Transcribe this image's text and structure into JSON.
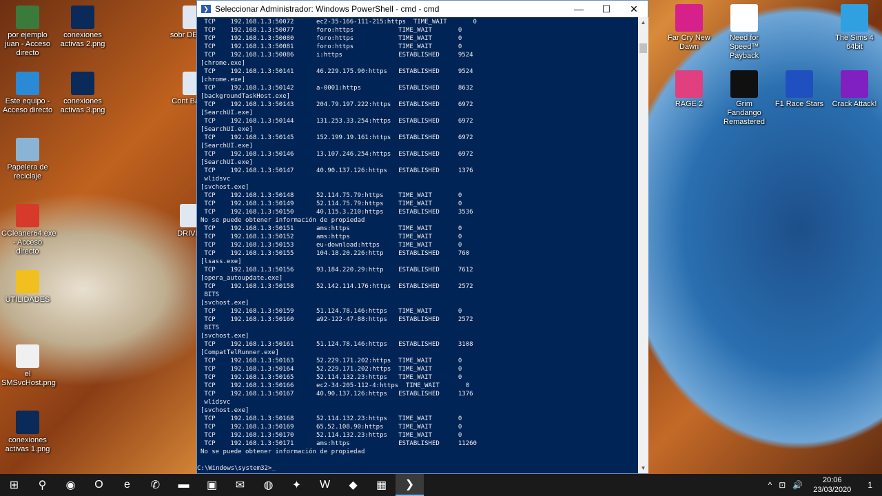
{
  "desktop": {
    "left_icons": [
      {
        "label": "por ejemplo juan - Acceso directo",
        "color": "#3a7a3a"
      },
      {
        "label": "conexiones activas 2.png",
        "color": "#0a2a5a"
      },
      {
        "label": "Este equipo - Acceso directo",
        "color": "#2a8ad6"
      },
      {
        "label": "conexiones activas 3.png",
        "color": "#0a2a5a"
      },
      {
        "label": "Papelera de reciclaje",
        "color": "#8ab4d6"
      },
      {
        "label": "CCleaner64.exe - Acceso directo",
        "color": "#d63a2a"
      },
      {
        "label": "UTILIDADES",
        "color": "#f0c020"
      },
      {
        "label": "el SMSvcHost.png",
        "color": "#f0f0f0"
      },
      {
        "label": "conexiones activas 1.png",
        "color": "#0a2a5a"
      }
    ],
    "partial_icons": [
      {
        "label": "sobr DESCAR"
      },
      {
        "label": "Cont Bascule"
      },
      {
        "label": "DRIVER"
      }
    ],
    "right_icons": [
      {
        "label": "Far Cry New Dawn",
        "color": "#d6208a"
      },
      {
        "label": "Need for Speed™ Payback",
        "color": "#ffffff"
      },
      {
        "label": "The Sims 4 64bit",
        "color": "#30a0e0"
      },
      {
        "label": "RAGE 2",
        "color": "#e04080"
      },
      {
        "label": "Grim Fandango Remastered",
        "color": "#101010"
      },
      {
        "label": "F1 Race Stars",
        "color": "#2050c0"
      },
      {
        "label": "Crack Attack!",
        "color": "#8020c0"
      }
    ]
  },
  "window": {
    "title": "Seleccionar Administrador: Windows PowerShell - cmd - cmd",
    "minimize": "—",
    "maximize": "☐",
    "close": "✕"
  },
  "console": {
    "rows": [
      {
        "proto": "TCP",
        "local": "192.168.1.3:50072",
        "foreign": "ec2-35-166-111-215:https",
        "state": "TIME_WAIT",
        "pid": "0"
      },
      {
        "proto": "TCP",
        "local": "192.168.1.3:50077",
        "foreign": "foro:https",
        "state": "TIME_WAIT",
        "pid": "0"
      },
      {
        "proto": "TCP",
        "local": "192.168.1.3:50080",
        "foreign": "foro:https",
        "state": "TIME_WAIT",
        "pid": "0"
      },
      {
        "proto": "TCP",
        "local": "192.168.1.3:50081",
        "foreign": "foro:https",
        "state": "TIME_WAIT",
        "pid": "0"
      },
      {
        "proto": "TCP",
        "local": "192.168.1.3:50086",
        "foreign": "i:https",
        "state": "ESTABLISHED",
        "pid": "9524"
      },
      {
        "text": "[chrome.exe]"
      },
      {
        "proto": "TCP",
        "local": "192.168.1.3:50141",
        "foreign": "46.229.175.90:https",
        "state": "ESTABLISHED",
        "pid": "9524"
      },
      {
        "text": "[chrome.exe]"
      },
      {
        "proto": "TCP",
        "local": "192.168.1.3:50142",
        "foreign": "a-0001:https",
        "state": "ESTABLISHED",
        "pid": "8632"
      },
      {
        "text": "[backgroundTaskHost.exe]"
      },
      {
        "proto": "TCP",
        "local": "192.168.1.3:50143",
        "foreign": "204.79.197.222:https",
        "state": "ESTABLISHED",
        "pid": "6972"
      },
      {
        "text": "[SearchUI.exe]"
      },
      {
        "proto": "TCP",
        "local": "192.168.1.3:50144",
        "foreign": "131.253.33.254:https",
        "state": "ESTABLISHED",
        "pid": "6972"
      },
      {
        "text": "[SearchUI.exe]"
      },
      {
        "proto": "TCP",
        "local": "192.168.1.3:50145",
        "foreign": "152.199.19.161:https",
        "state": "ESTABLISHED",
        "pid": "6972"
      },
      {
        "text": "[SearchUI.exe]"
      },
      {
        "proto": "TCP",
        "local": "192.168.1.3:50146",
        "foreign": "13.107.246.254:https",
        "state": "ESTABLISHED",
        "pid": "6972"
      },
      {
        "text": "[SearchUI.exe]"
      },
      {
        "proto": "TCP",
        "local": "192.168.1.3:50147",
        "foreign": "40.90.137.126:https",
        "state": "ESTABLISHED",
        "pid": "1376"
      },
      {
        "text": " wlidsvc"
      },
      {
        "text": "[svchost.exe]"
      },
      {
        "proto": "TCP",
        "local": "192.168.1.3:50148",
        "foreign": "52.114.75.79:https",
        "state": "TIME_WAIT",
        "pid": "0"
      },
      {
        "proto": "TCP",
        "local": "192.168.1.3:50149",
        "foreign": "52.114.75.79:https",
        "state": "TIME_WAIT",
        "pid": "0"
      },
      {
        "proto": "TCP",
        "local": "192.168.1.3:50150",
        "foreign": "40.115.3.210:https",
        "state": "ESTABLISHED",
        "pid": "3536"
      },
      {
        "text": "No se puede obtener información de propiedad"
      },
      {
        "proto": "TCP",
        "local": "192.168.1.3:50151",
        "foreign": "ams:https",
        "state": "TIME_WAIT",
        "pid": "0"
      },
      {
        "proto": "TCP",
        "local": "192.168.1.3:50152",
        "foreign": "ams:https",
        "state": "TIME_WAIT",
        "pid": "0"
      },
      {
        "proto": "TCP",
        "local": "192.168.1.3:50153",
        "foreign": "eu-download:https",
        "state": "TIME_WAIT",
        "pid": "0"
      },
      {
        "proto": "TCP",
        "local": "192.168.1.3:50155",
        "foreign": "104.18.20.226:http",
        "state": "ESTABLISHED",
        "pid": "760"
      },
      {
        "text": "[lsass.exe]"
      },
      {
        "proto": "TCP",
        "local": "192.168.1.3:50156",
        "foreign": "93.184.220.29:http",
        "state": "ESTABLISHED",
        "pid": "7612"
      },
      {
        "text": "[opera_autoupdate.exe]"
      },
      {
        "proto": "TCP",
        "local": "192.168.1.3:50158",
        "foreign": "52.142.114.176:https",
        "state": "ESTABLISHED",
        "pid": "2572"
      },
      {
        "text": " BITS"
      },
      {
        "text": "[svchost.exe]"
      },
      {
        "proto": "TCP",
        "local": "192.168.1.3:50159",
        "foreign": "51.124.78.146:https",
        "state": "TIME_WAIT",
        "pid": "0"
      },
      {
        "proto": "TCP",
        "local": "192.168.1.3:50160",
        "foreign": "a92-122-47-88:https",
        "state": "ESTABLISHED",
        "pid": "2572"
      },
      {
        "text": " BITS"
      },
      {
        "text": "[svchost.exe]"
      },
      {
        "proto": "TCP",
        "local": "192.168.1.3:50161",
        "foreign": "51.124.78.146:https",
        "state": "ESTABLISHED",
        "pid": "3108"
      },
      {
        "text": "[CompatTelRunner.exe]"
      },
      {
        "proto": "TCP",
        "local": "192.168.1.3:50163",
        "foreign": "52.229.171.202:https",
        "state": "TIME_WAIT",
        "pid": "0"
      },
      {
        "proto": "TCP",
        "local": "192.168.1.3:50164",
        "foreign": "52.229.171.202:https",
        "state": "TIME_WAIT",
        "pid": "0"
      },
      {
        "proto": "TCP",
        "local": "192.168.1.3:50165",
        "foreign": "52.114.132.23:https",
        "state": "TIME_WAIT",
        "pid": "0"
      },
      {
        "proto": "TCP",
        "local": "192.168.1.3:50166",
        "foreign": "ec2-34-205-112-4:https",
        "state": "TIME_WAIT",
        "pid": "0"
      },
      {
        "proto": "TCP",
        "local": "192.168.1.3:50167",
        "foreign": "40.90.137.126:https",
        "state": "ESTABLISHED",
        "pid": "1376"
      },
      {
        "text": " wlidsvc"
      },
      {
        "text": "[svchost.exe]"
      },
      {
        "proto": "TCP",
        "local": "192.168.1.3:50168",
        "foreign": "52.114.132.23:https",
        "state": "TIME_WAIT",
        "pid": "0"
      },
      {
        "proto": "TCP",
        "local": "192.168.1.3:50169",
        "foreign": "65.52.108.90:https",
        "state": "TIME_WAIT",
        "pid": "0"
      },
      {
        "proto": "TCP",
        "local": "192.168.1.3:50170",
        "foreign": "52.114.132.23:https",
        "state": "TIME_WAIT",
        "pid": "0"
      },
      {
        "proto": "TCP",
        "local": "192.168.1.3:50171",
        "foreign": "ams:https",
        "state": "ESTABLISHED",
        "pid": "11260"
      },
      {
        "text": "No se puede obtener información de propiedad"
      },
      {
        "text": ""
      }
    ],
    "prompt": "C:\\Windows\\system32>",
    "background": "#012456"
  },
  "taskbar": {
    "apps": [
      {
        "name": "start",
        "icon": "windows-icon",
        "glyph": "⊞"
      },
      {
        "name": "search",
        "icon": "search-icon",
        "glyph": "⚲"
      },
      {
        "name": "chrome",
        "icon": "chrome-icon",
        "glyph": "◉"
      },
      {
        "name": "opera",
        "icon": "opera-icon",
        "glyph": "O"
      },
      {
        "name": "edge",
        "icon": "edge-icon",
        "glyph": "e"
      },
      {
        "name": "whatsapp",
        "icon": "whatsapp-icon",
        "glyph": "✆"
      },
      {
        "name": "explorer",
        "icon": "folder-icon",
        "glyph": "▬"
      },
      {
        "name": "store",
        "icon": "store-icon",
        "glyph": "▣"
      },
      {
        "name": "mail",
        "icon": "mail-icon",
        "glyph": "✉"
      },
      {
        "name": "app1",
        "icon": "app-icon",
        "glyph": "◍"
      },
      {
        "name": "app2",
        "icon": "app-icon",
        "glyph": "✦"
      },
      {
        "name": "word",
        "icon": "word-icon",
        "glyph": "W"
      },
      {
        "name": "app3",
        "icon": "app-icon",
        "glyph": "◆"
      },
      {
        "name": "calculator",
        "icon": "calculator-icon",
        "glyph": "▦"
      },
      {
        "name": "powershell",
        "icon": "powershell-icon",
        "glyph": "❯"
      }
    ],
    "tray": {
      "chevron": "^",
      "network": "⊡",
      "volume": "🔊",
      "time": "20:06",
      "date": "23/03/2020",
      "notifications": "1"
    }
  }
}
